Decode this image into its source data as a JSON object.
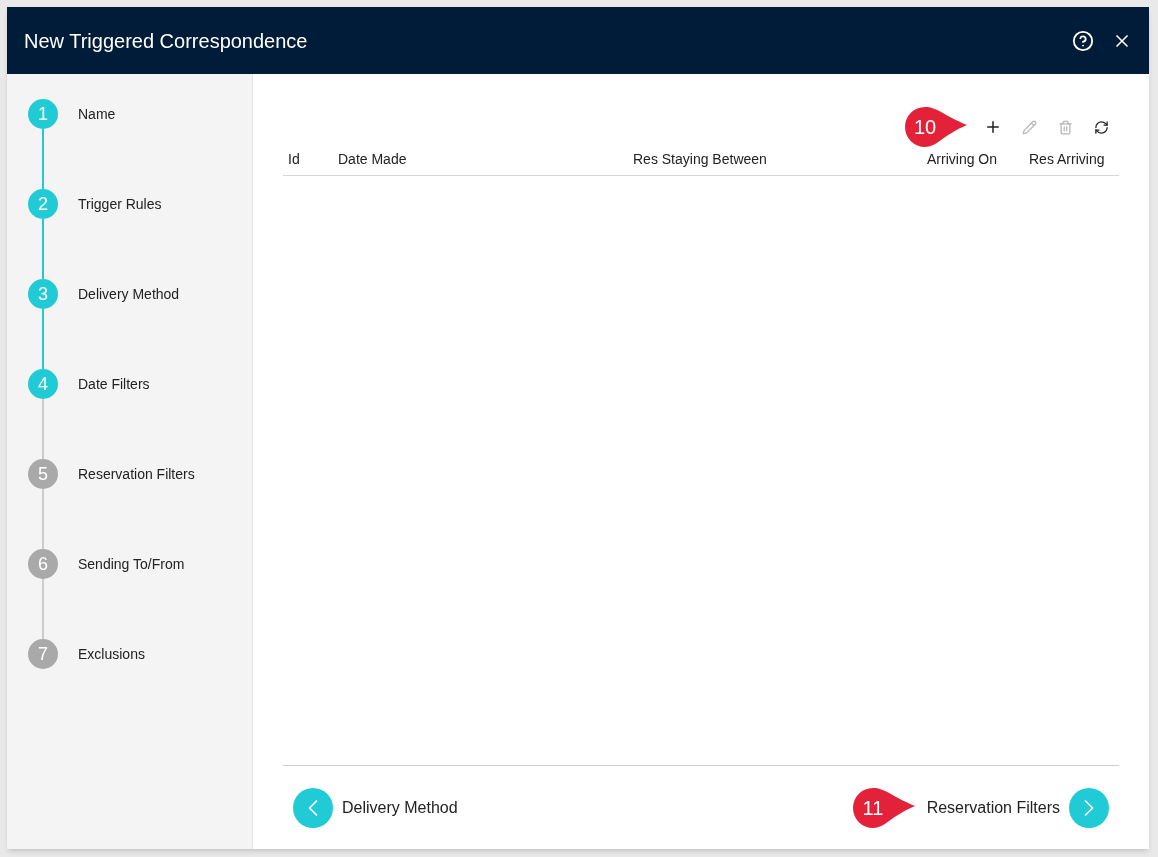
{
  "window": {
    "title": "New Triggered Correspondence"
  },
  "steps": [
    {
      "number": "1",
      "label": "Name",
      "done": true
    },
    {
      "number": "2",
      "label": "Trigger Rules",
      "done": true
    },
    {
      "number": "3",
      "label": "Delivery Method",
      "done": true
    },
    {
      "number": "4",
      "label": "Date Filters",
      "done": true
    },
    {
      "number": "5",
      "label": "Reservation Filters",
      "done": false
    },
    {
      "number": "6",
      "label": "Sending To/From",
      "done": false
    },
    {
      "number": "7",
      "label": "Exclusions",
      "done": false
    }
  ],
  "toolbar": {
    "callout": "10",
    "tools": [
      {
        "kind": "add",
        "disabled": false
      },
      {
        "kind": "edit",
        "disabled": true
      },
      {
        "kind": "delete",
        "disabled": true
      },
      {
        "kind": "refresh",
        "disabled": false
      }
    ]
  },
  "table": {
    "columns": [
      "Id",
      "Date Made",
      "Res Staying Between",
      "Arriving On",
      "Res Arriving"
    ]
  },
  "footer": {
    "back": "Delivery Method",
    "next": "Reservation Filters",
    "callout": "11"
  }
}
